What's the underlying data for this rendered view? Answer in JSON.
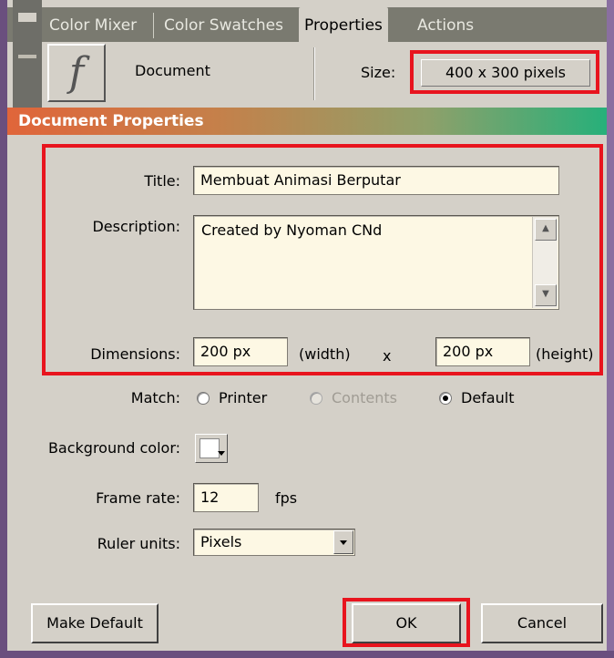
{
  "tabs": [
    "Color Mixer",
    "Color Swatches",
    "Properties",
    "Actions"
  ],
  "active_tab_index": 2,
  "properties_panel": {
    "icon": "flash-icon",
    "doc_label": "Document",
    "size_label": "Size:",
    "size_value": "400 x 300 pixels"
  },
  "dialog": {
    "title": "Document Properties",
    "title_label": "Title:",
    "title_value": "Membuat Animasi Berputar",
    "description_label": "Description:",
    "description_value": "Created by Nyoman CNd",
    "dimensions_label": "Dimensions:",
    "width_value": "200 px",
    "width_suffix": "(width)",
    "x_sep": "x",
    "height_value": "200 px",
    "height_suffix": "(height)",
    "match_label": "Match:",
    "match_options": [
      "Printer",
      "Contents",
      "Default"
    ],
    "match_selected": "Default",
    "background_label": "Background color:",
    "background_color": "#ffffff",
    "frame_rate_label": "Frame rate:",
    "frame_rate_value": "12",
    "fps_label": "fps",
    "ruler_label": "Ruler units:",
    "ruler_value": "Pixels",
    "buttons": {
      "make_default": "Make Default",
      "ok": "OK",
      "cancel": "Cancel"
    }
  },
  "colors": {
    "highlight": "#e8141e",
    "dialog_bg": "#d4d0c8",
    "field_bg": "#fdf8e4"
  }
}
